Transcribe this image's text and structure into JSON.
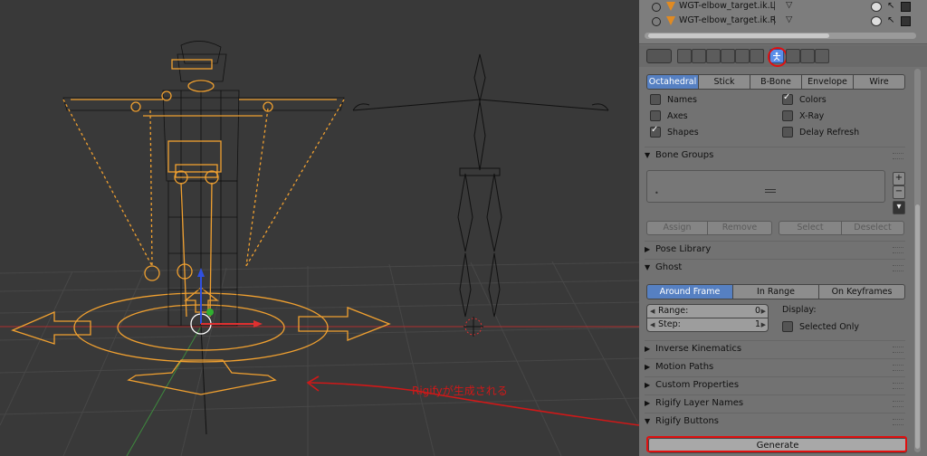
{
  "outliner": {
    "rows": [
      {
        "name": "WGT-elbow_target.ik.L"
      },
      {
        "name": "WGT-elbow_target.ik.R"
      }
    ]
  },
  "properties": {
    "display_modes": [
      "Octahedral",
      "Stick",
      "B-Bone",
      "Envelope",
      "Wire"
    ],
    "display_mode_active": "Octahedral",
    "checks": {
      "names": {
        "label": "Names",
        "checked": false
      },
      "colors": {
        "label": "Colors",
        "checked": true
      },
      "axes": {
        "label": "Axes",
        "checked": false
      },
      "xray": {
        "label": "X-Ray",
        "checked": false
      },
      "shapes": {
        "label": "Shapes",
        "checked": true
      },
      "delay": {
        "label": "Delay Refresh",
        "checked": false
      }
    },
    "bone_groups": {
      "title": "Bone Groups",
      "buttons": {
        "assign": "Assign",
        "remove": "Remove",
        "select": "Select",
        "deselect": "Deselect"
      }
    },
    "pose_library": "Pose Library",
    "ghost": {
      "title": "Ghost",
      "modes": [
        "Around Frame",
        "In Range",
        "On Keyframes"
      ],
      "mode_active": "Around Frame",
      "range_label": "Range:",
      "range_value": "0",
      "step_label": "Step:",
      "step_value": "1",
      "display_label": "Display:",
      "selected_only": "Selected Only"
    },
    "panels": {
      "ik": "Inverse Kinematics",
      "motion": "Motion Paths",
      "custom": "Custom Properties",
      "rigify_layers": "Rigify Layer Names",
      "rigify_buttons": "Rigify Buttons"
    },
    "generate_label": "Generate"
  },
  "annotation": {
    "text": "Rigifyが生成される",
    "color": "#d01818"
  },
  "colors": {
    "selected_bone": "#f0a030",
    "active_tab": "#5b8ee8",
    "highlight_ring": "#e01010"
  }
}
